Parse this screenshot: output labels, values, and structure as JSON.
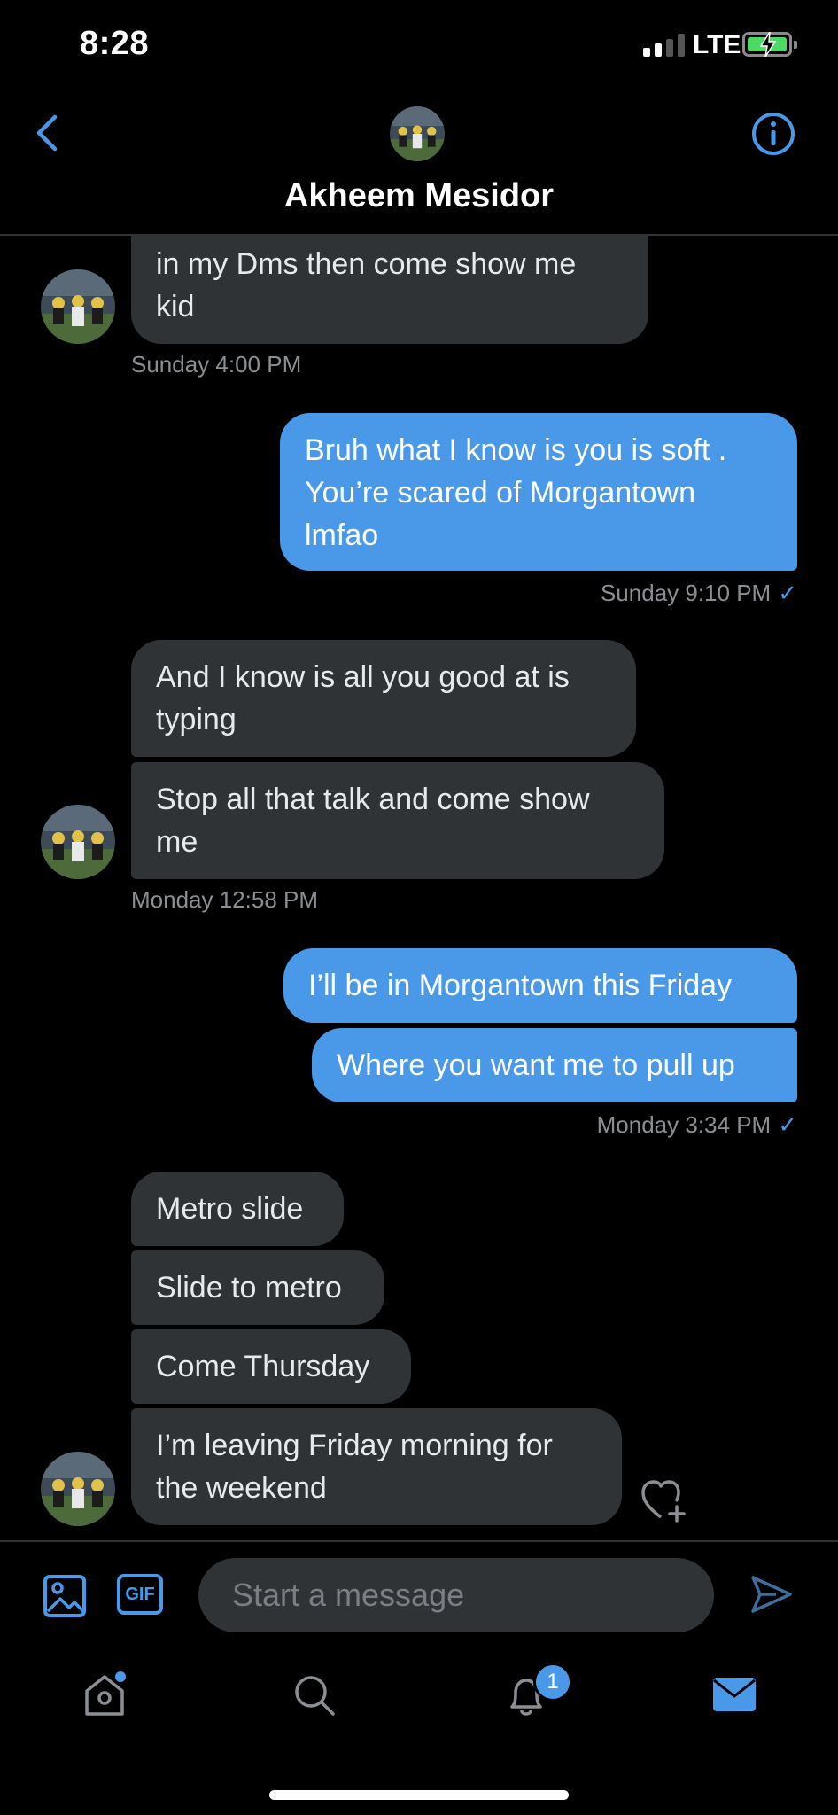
{
  "status_bar": {
    "time": "8:28",
    "network": "LTE"
  },
  "header": {
    "contact_name": "Akheem Mesidor"
  },
  "messages": [
    {
      "text": "in my Dms then come show me kid",
      "line1": "in my Dms then come show me",
      "line2": "kid"
    },
    {
      "meta": "Sunday 4:00 PM"
    },
    {
      "line1": "Bruh what I know is you is soft .",
      "line2": "You’re scared of Morgantown",
      "line3": "lmfao"
    },
    {
      "meta": "Sunday 9:10 PM"
    },
    {
      "line1": "And I know is all you good at is",
      "line2": "typing"
    },
    {
      "line1": "Stop all that talk and come show",
      "line2": "me"
    },
    {
      "meta": "Monday 12:58 PM"
    },
    {
      "text": "I’ll be in Morgantown this Friday"
    },
    {
      "text": "Where you want me to pull up"
    },
    {
      "meta": "Monday 3:34 PM"
    },
    {
      "text": "Metro slide"
    },
    {
      "text": "Slide to metro"
    },
    {
      "text": "Come Thursday"
    },
    {
      "line1": "I’m leaving Friday morning for",
      "line2": "the weekend"
    }
  ],
  "read_check": "✓",
  "compose": {
    "placeholder": "Start a message",
    "gif_label": "GIF"
  },
  "nav": {
    "notifications_badge": "1"
  },
  "colors": {
    "accent": "#4a99e9",
    "incoming_bubble": "#2f3336",
    "background": "#000000"
  }
}
